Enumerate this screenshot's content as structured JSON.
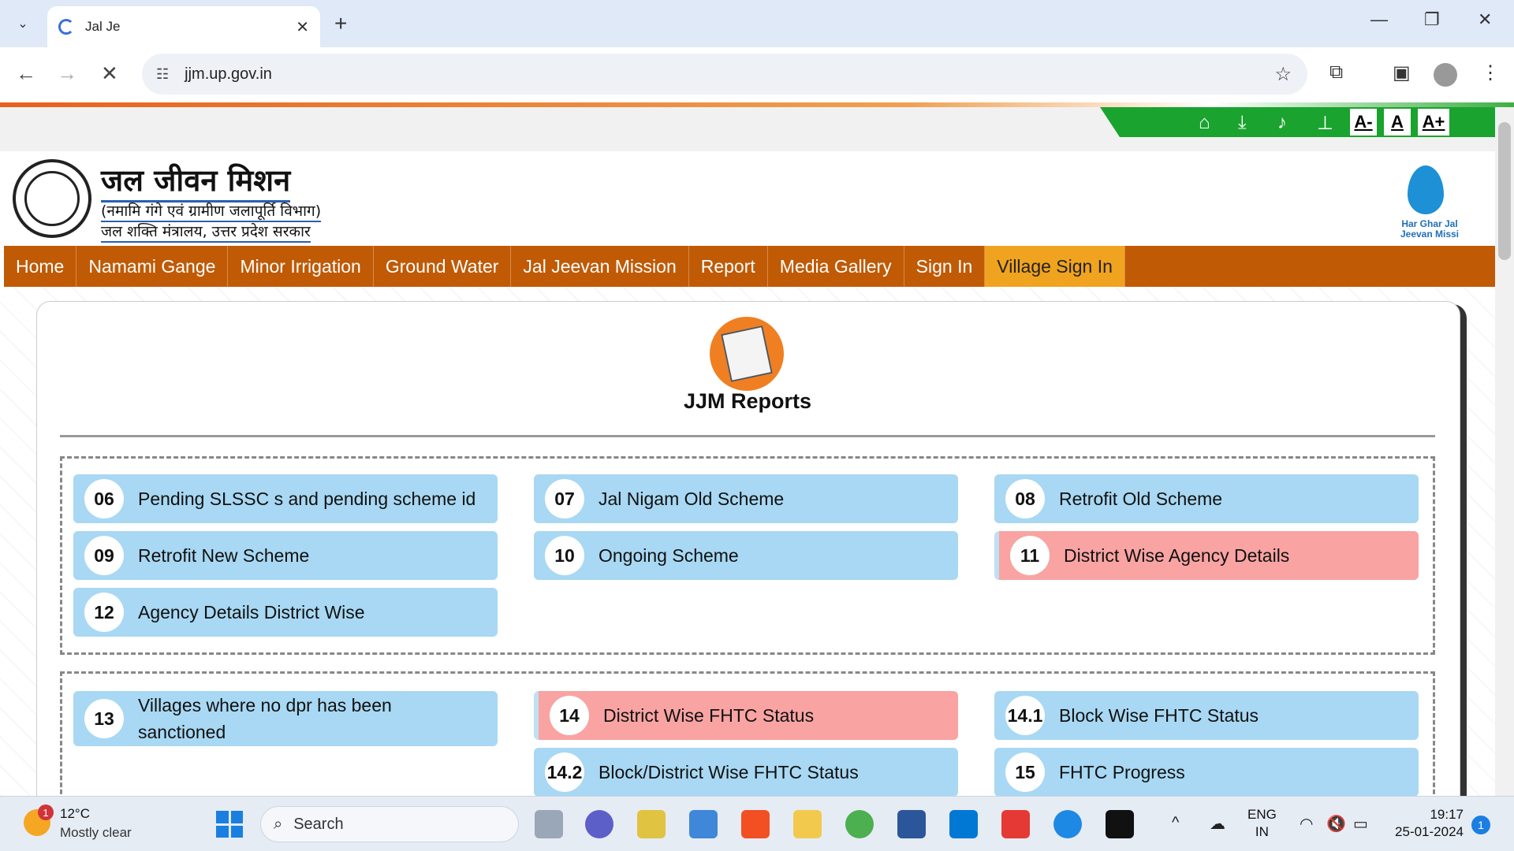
{
  "browser": {
    "tab_title": "Jal Je",
    "url": "jjm.up.gov.in"
  },
  "site": {
    "title_hi": "जल जीवन मिशन",
    "subtitle1_hi": "(नमामि गंगे एवं ग्रामीण जलापूर्ति विभाग)",
    "subtitle2_hi": "जल शक्ति मंत्रालय, उत्तर प्रदेश सरकार",
    "logo_right_line1": "Har Ghar Jal",
    "logo_right_line2": "Jeevan Missi",
    "font_buttons": [
      "A-",
      "A",
      "A+"
    ]
  },
  "nav": {
    "items": [
      "Home",
      "Namami Gange",
      "Minor Irrigation",
      "Ground Water",
      "Jal Jeevan Mission",
      "Report",
      "Media Gallery",
      "Sign In",
      "Village Sign In"
    ]
  },
  "reports": {
    "heading": "JJM Reports",
    "group1": [
      {
        "num": "06",
        "label": "Pending SLSSC s and pending scheme id"
      },
      {
        "num": "07",
        "label": "Jal Nigam Old Scheme"
      },
      {
        "num": "08",
        "label": "Retrofit Old Scheme"
      },
      {
        "num": "09",
        "label": "Retrofit New Scheme"
      },
      {
        "num": "10",
        "label": "Ongoing Scheme"
      },
      {
        "num": "11",
        "label": "District Wise Agency Details"
      },
      {
        "num": "12",
        "label": "Agency Details District Wise"
      }
    ],
    "group2": [
      {
        "num": "13",
        "label": "Villages where no dpr has been sanctioned"
      },
      {
        "num": "14",
        "label": "District Wise FHTC Status"
      },
      {
        "num": "14.1",
        "label": "Block Wise FHTC Status"
      },
      {
        "num": "14.2",
        "label": "Block/District Wise FHTC Status"
      },
      {
        "num": "15",
        "label": "FHTC Progress"
      }
    ]
  },
  "taskbar": {
    "temp": "12°C",
    "weather": "Mostly clear",
    "weather_badge": "1",
    "search": "Search",
    "lang1": "ENG",
    "lang2": "IN",
    "time": "19:17",
    "date": "25-01-2024",
    "notif_count": "1"
  },
  "colors": {
    "nav_bg": "#c05a05",
    "nav_active": "#f0a31e",
    "report_item": "#a8d8f3",
    "report_item_highlight": "#f9a3a3",
    "util_green": "#1aa32f"
  }
}
